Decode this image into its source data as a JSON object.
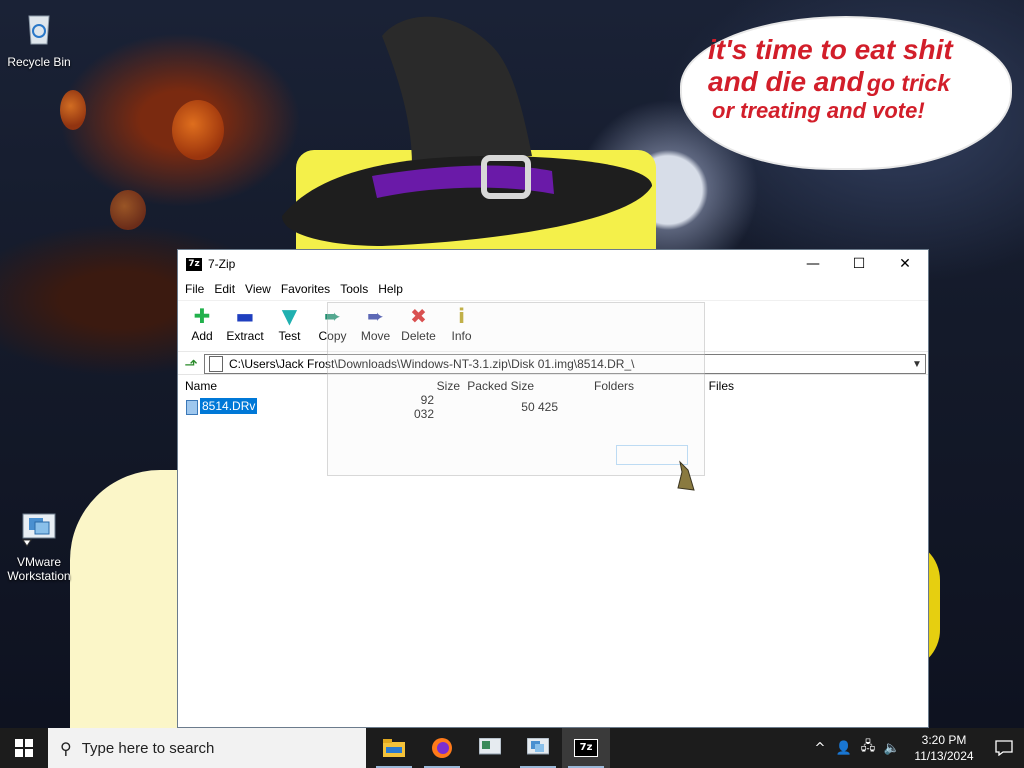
{
  "desktop": {
    "speech_bubble": {
      "line1": "it's time to eat shit",
      "line2_big": "and die and",
      "line2_small": "go trick",
      "line3": "or treating and vote!"
    },
    "icons": [
      {
        "name": "recycle-bin",
        "label": "Recycle Bin"
      },
      {
        "name": "vmware",
        "label_line1": "VMware",
        "label_line2": "Workstation"
      }
    ]
  },
  "window": {
    "title": "7-Zip",
    "app_icon_text": "7z",
    "controls": {
      "minimize": "—",
      "maximize": "☐",
      "close": "✕"
    },
    "menu": [
      "File",
      "Edit",
      "View",
      "Favorites",
      "Tools",
      "Help"
    ],
    "toolbar": [
      {
        "id": "add",
        "label": "Add",
        "glyph": "✚",
        "color": "#22b14c"
      },
      {
        "id": "extract",
        "label": "Extract",
        "glyph": "▬",
        "color": "#1f3fbf"
      },
      {
        "id": "test",
        "label": "Test",
        "glyph": "▼",
        "color": "#20b0b0"
      },
      {
        "id": "copy",
        "label": "Copy",
        "glyph": "➨",
        "color": "#1f8f6f"
      },
      {
        "id": "move",
        "label": "Move",
        "glyph": "➨",
        "color": "#2a3aa0"
      },
      {
        "id": "delete",
        "label": "Delete",
        "glyph": "✖",
        "color": "#d01a1a"
      },
      {
        "id": "info",
        "label": "Info",
        "glyph": "i",
        "color": "#b09a10"
      }
    ],
    "address": {
      "path": "C:\\Users\\Jack Frost\\Downloads\\Windows-NT-3.1.zip\\Disk 01.img\\8514.DR_\\"
    },
    "columns": {
      "name": "Name",
      "size": "Size",
      "packed": "Packed Size",
      "folders": "Folders",
      "files": "Files"
    },
    "files": [
      {
        "name": "8514.DRv",
        "size": "92 032",
        "packed": "50 425",
        "folders": "",
        "files": ""
      }
    ]
  },
  "taskbar": {
    "search_placeholder": "Type here to search",
    "apps": [
      "file-explorer",
      "firefox",
      "vmware-console",
      "vmware-workstation",
      "7-zip"
    ],
    "active_app": "7-zip",
    "tray": {
      "chevron": "^",
      "network": "🖧",
      "volume": "🔈"
    },
    "clock": {
      "time": "3:20 PM",
      "date": "11/13/2024"
    }
  },
  "colors": {
    "speech_text": "#d21e2a",
    "selection": "#0078d7",
    "taskbar": "#1c1c1c"
  }
}
